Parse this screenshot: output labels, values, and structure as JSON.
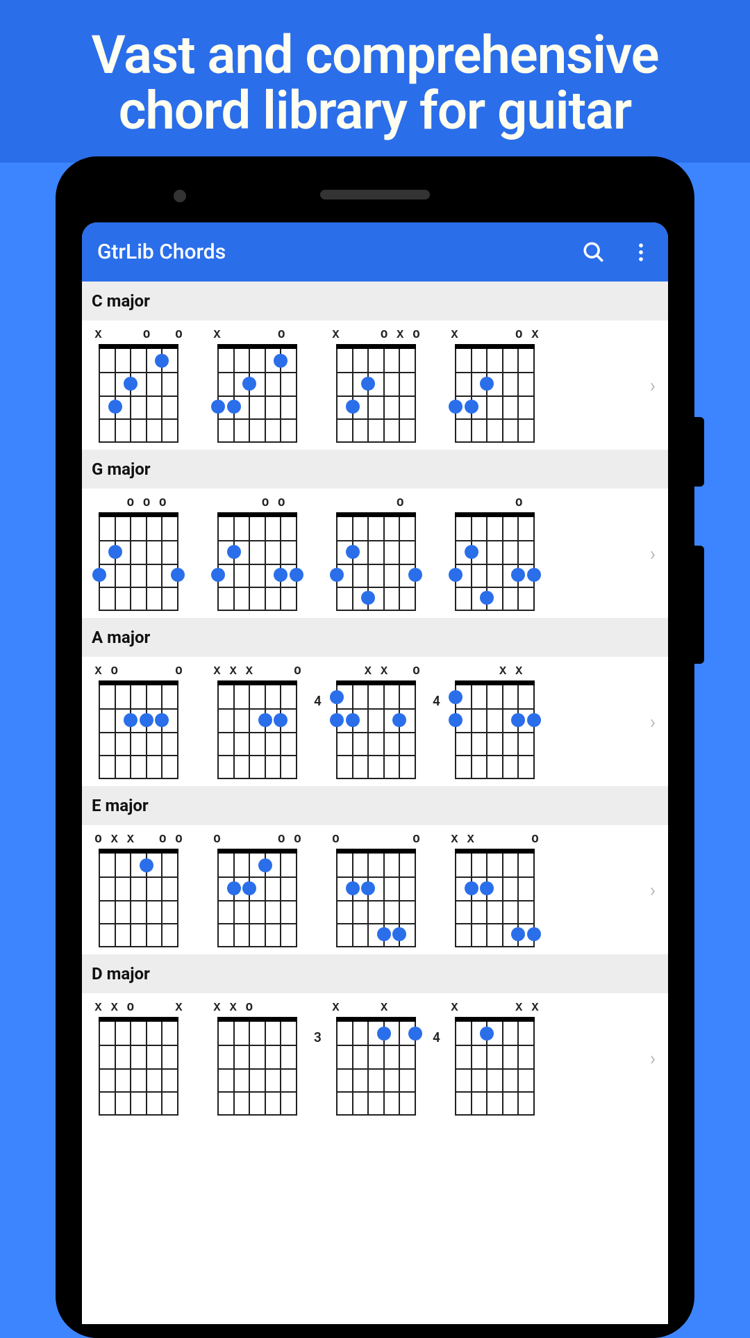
{
  "banner": "Vast and comprehensive chord library for guitar",
  "app_title": "GtrLib Chords",
  "sections": [
    {
      "name": "C major",
      "chords": [
        {
          "markers": [
            "X",
            "",
            "",
            "O",
            "",
            "O"
          ],
          "fret": null,
          "dots": [
            [
              1,
              2
            ],
            [
              2,
              4
            ],
            [
              3,
              5
            ]
          ]
        },
        {
          "markers": [
            "X",
            "",
            "",
            "",
            "O",
            ""
          ],
          "fret": null,
          "dots": [
            [
              1,
              2
            ],
            [
              2,
              4
            ],
            [
              3,
              5
            ],
            [
              3,
              6
            ]
          ]
        },
        {
          "markers": [
            "X",
            "",
            "",
            "O",
            "X",
            "O"
          ],
          "fret": null,
          "dots": [
            [
              2,
              4
            ],
            [
              3,
              5
            ]
          ]
        },
        {
          "markers": [
            "X",
            "",
            "",
            "",
            "O",
            "X"
          ],
          "fret": null,
          "dots": [
            [
              2,
              4
            ],
            [
              3,
              5
            ],
            [
              3,
              6
            ]
          ]
        }
      ]
    },
    {
      "name": "G major",
      "chords": [
        {
          "markers": [
            "",
            "",
            "O",
            "O",
            "O",
            ""
          ],
          "fret": null,
          "dots": [
            [
              2,
              5
            ],
            [
              3,
              6
            ],
            [
              3,
              1
            ]
          ]
        },
        {
          "markers": [
            "",
            "",
            "",
            "O",
            "O",
            ""
          ],
          "fret": null,
          "dots": [
            [
              2,
              5
            ],
            [
              3,
              6
            ],
            [
              3,
              2
            ],
            [
              3,
              1
            ]
          ]
        },
        {
          "markers": [
            "",
            "",
            "",
            "",
            "O",
            ""
          ],
          "fret": null,
          "dots": [
            [
              2,
              5
            ],
            [
              3,
              6
            ],
            [
              3,
              1
            ],
            [
              4,
              4
            ]
          ]
        },
        {
          "markers": [
            "",
            "",
            "",
            "",
            "O",
            ""
          ],
          "fret": null,
          "dots": [
            [
              2,
              5
            ],
            [
              3,
              6
            ],
            [
              3,
              2
            ],
            [
              3,
              1
            ],
            [
              4,
              4
            ]
          ]
        }
      ]
    },
    {
      "name": "A major",
      "chords": [
        {
          "markers": [
            "X",
            "O",
            "",
            "",
            "",
            "O"
          ],
          "fret": null,
          "dots": [
            [
              2,
              4
            ],
            [
              2,
              3
            ],
            [
              2,
              2
            ]
          ]
        },
        {
          "markers": [
            "X",
            "X",
            "X",
            "",
            "",
            "O"
          ],
          "fret": null,
          "dots": [
            [
              2,
              3
            ],
            [
              2,
              2
            ]
          ]
        },
        {
          "markers": [
            "",
            "",
            "X",
            "X",
            "",
            "O"
          ],
          "fret": "4",
          "dots": [
            [
              1,
              6
            ],
            [
              2,
              6
            ],
            [
              2,
              5
            ],
            [
              2,
              2
            ]
          ]
        },
        {
          "markers": [
            "",
            "",
            "",
            "X",
            "X",
            ""
          ],
          "fret": "4",
          "dots": [
            [
              1,
              6
            ],
            [
              2,
              6
            ],
            [
              2,
              2
            ],
            [
              2,
              1
            ]
          ]
        }
      ]
    },
    {
      "name": "E major",
      "chords": [
        {
          "markers": [
            "O",
            "X",
            "X",
            "",
            "O",
            "O"
          ],
          "fret": null,
          "dots": [
            [
              1,
              3
            ]
          ]
        },
        {
          "markers": [
            "O",
            "",
            "",
            "",
            "O",
            "O"
          ],
          "fret": null,
          "dots": [
            [
              1,
              3
            ],
            [
              2,
              5
            ],
            [
              2,
              4
            ]
          ]
        },
        {
          "markers": [
            "O",
            "",
            "",
            "",
            "",
            "O"
          ],
          "fret": null,
          "dots": [
            [
              2,
              5
            ],
            [
              2,
              4
            ],
            [
              4,
              3
            ],
            [
              4,
              2
            ]
          ]
        },
        {
          "markers": [
            "X",
            "X",
            "",
            "",
            "",
            "O"
          ],
          "fret": null,
          "dots": [
            [
              2,
              4
            ],
            [
              2,
              5
            ],
            [
              4,
              2
            ],
            [
              4,
              1
            ]
          ]
        }
      ]
    },
    {
      "name": "D major",
      "chords": [
        {
          "markers": [
            "X",
            "X",
            "O",
            "",
            "",
            "X"
          ],
          "fret": null,
          "dots": []
        },
        {
          "markers": [
            "X",
            "X",
            "O",
            "",
            "",
            ""
          ],
          "fret": null,
          "dots": []
        },
        {
          "markers": [
            "X",
            "",
            "",
            "X",
            "",
            ""
          ],
          "fret": "3",
          "dots": [
            [
              1,
              3
            ],
            [
              1,
              1
            ]
          ]
        },
        {
          "markers": [
            "X",
            "",
            "",
            "",
            "X",
            "X"
          ],
          "fret": "4",
          "dots": [
            [
              1,
              4
            ]
          ]
        }
      ]
    }
  ]
}
